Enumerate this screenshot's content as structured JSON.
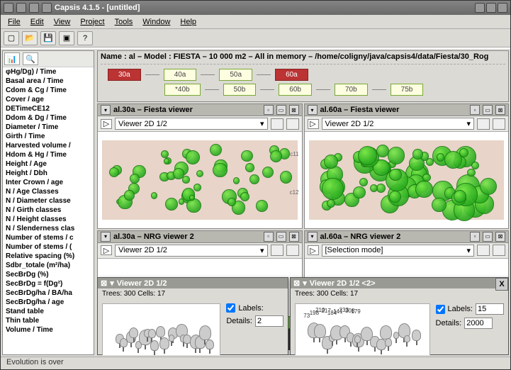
{
  "app": {
    "title": "Capsis 4.1.5 - [untitled]"
  },
  "menu": {
    "file": "File",
    "edit": "Edit",
    "view": "View",
    "project": "Project",
    "tools": "Tools",
    "window": "Window",
    "help": "Help"
  },
  "sidebar": {
    "items": [
      "φHg/Dg) / Time",
      "Basal area / Time",
      "Cdom & Cg / Time",
      "Cover / age",
      "DETimeCE12",
      "Ddom & Dg / Time",
      "Diameter / Time",
      "Girth / Time",
      "Harvested volume /",
      "Hdom & Hg / Time",
      "Height / Age",
      "Height / Dbh",
      "Inter Crown / age",
      "N / Age Classes",
      "N / Diameter classe",
      "N / Girth classes",
      "N / Height classes",
      "N / Slenderness clas",
      "Number of stems / c",
      "Number of stems / (",
      "Relative spacing (%)",
      "Sdbr_totale (m²/ha)",
      "SecBrDg (%)",
      "SecBrDg = f(Dg²)",
      "SecBrDg/ha / BA/ha",
      "SecBrDg/ha / age",
      "Stand table",
      "Thin table",
      "Volume / Time"
    ]
  },
  "header": {
    "name_line": "Name : al – Model : FIESTA – 10 000 m2 – All in memory – /home/coligny/java/capsis4/data/Fiesta/30_Rog"
  },
  "scenario": {
    "row1": [
      "30a",
      "40a",
      "50a",
      "60a"
    ],
    "row1_active": [
      true,
      false,
      false,
      true
    ],
    "row2": [
      "*40b",
      "50b",
      "60b",
      "70b",
      "75b"
    ]
  },
  "panels": {
    "tl": {
      "title": "al.30a – Fiesta viewer",
      "combo": "Viewer 2D 1/2",
      "cells": [
        "c11",
        "c12"
      ]
    },
    "tr": {
      "title": "al.60a – Fiesta viewer",
      "combo": "Viewer 2D 1/2"
    },
    "bl": {
      "title": "al.30a – NRG viewer 2",
      "combo": "Viewer 2D 1/2"
    },
    "br": {
      "title": "al.60a – NRG viewer 2",
      "combo": "[Selection mode]"
    }
  },
  "float1": {
    "title": "Viewer 2D 1/2",
    "info": "Trees: 300 Cells: 17",
    "labels_label": "Labels:",
    "details_label": "Details:",
    "details_value": "2"
  },
  "float2": {
    "title": "Viewer 2D 1/2 <2>",
    "info": "Trees: 300 Cells: 17",
    "labels_label": "Labels:",
    "labels_value": "15",
    "details_label": "Details:",
    "details_value": "2000",
    "tree_labels": [
      "73",
      "198",
      "210",
      "217",
      "184",
      "141",
      "233",
      "308",
      "179"
    ]
  },
  "status": {
    "text": "Evolution is over"
  }
}
